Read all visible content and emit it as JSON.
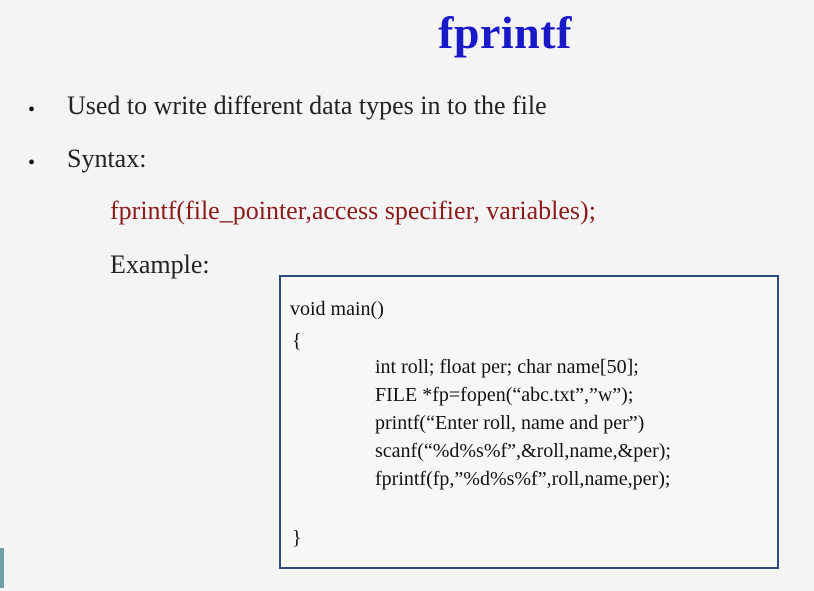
{
  "slide": {
    "title": "fprintf",
    "bullets": [
      "Used to write different data types in to the file",
      "Syntax:"
    ],
    "syntax_line": "fprintf(file_pointer,access specifier, variables);",
    "example_label": "Example:",
    "code": {
      "header": "void main()",
      "open_brace": "{",
      "body": [
        "int roll; float per; char name[50];",
        "FILE *fp=fopen(“abc.txt”,”w”);",
        "printf(“Enter roll, name and per”)",
        "scanf(“%d%s%f”,&roll,name,&per);",
        "fprintf(fp,”%d%s%f”,roll,name,per);"
      ],
      "close_brace": "}"
    },
    "colors": {
      "title": "#1a19c8",
      "syntax": "#8b1a1a",
      "box_border": "#2e4c7a"
    }
  }
}
